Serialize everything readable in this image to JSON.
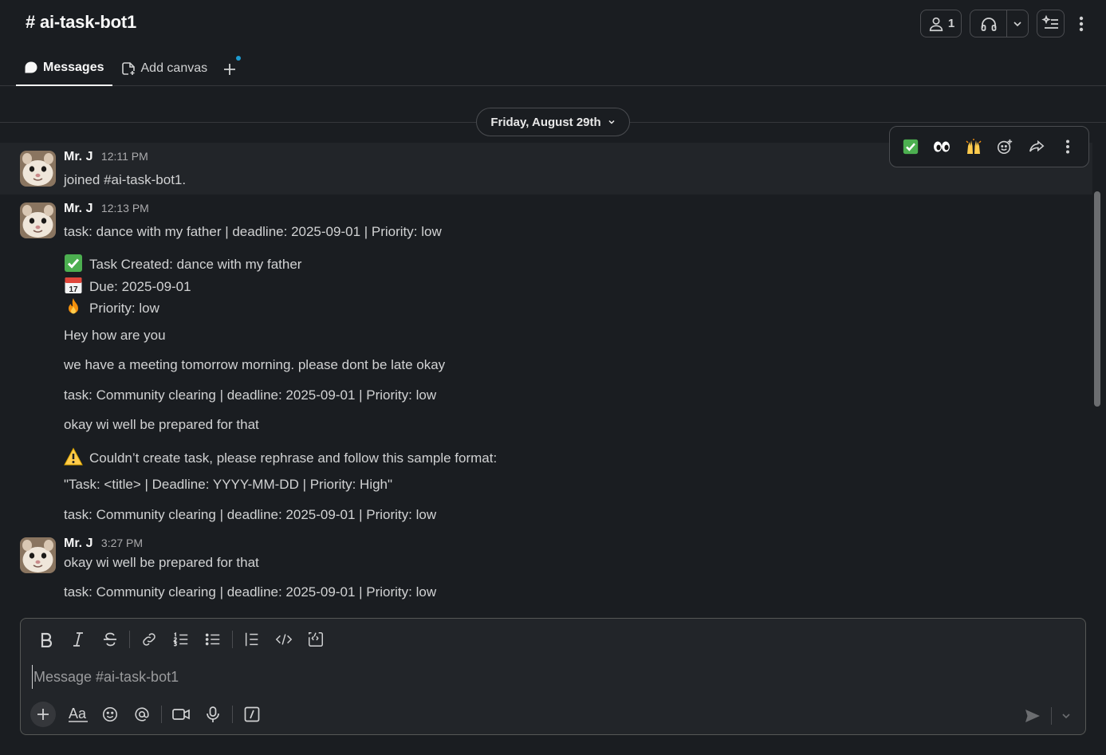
{
  "header": {
    "channel_title": "# ai-task-bot1",
    "member_count": "1"
  },
  "tabs": [
    {
      "label": "Messages",
      "active": true
    },
    {
      "label": "Add canvas",
      "active": false
    }
  ],
  "date_divider": "Friday, August 29th",
  "messages": [
    {
      "author": "Mr. J",
      "time": "12:11 PM",
      "lines": [
        "joined #ai-task-bot1."
      ]
    },
    {
      "author": "Mr. J",
      "time": "12:13 PM",
      "lines": [
        "task: dance with my father | deadline: 2025-09-01 | Priority: low",
        "Task Created: dance with my father",
        "Due: 2025-09-01",
        "Priority: low",
        "Hey how are you",
        "we have a meeting tomorrow morning. please dont be late okay",
        "task: Community clearing | deadline: 2025-09-01 | Priority: low",
        "okay wi well be prepared for that",
        "Couldn’t create task, please rephrase and follow this sample format:",
        "\"Task: <title> | Deadline: YYYY-MM-DD | Priority: High\"",
        "task: Community clearing | deadline: 2025-09-01 | Priority: low"
      ]
    },
    {
      "author": "Mr. J",
      "time": "3:27 PM",
      "lines": [
        "okay wi well be prepared for that",
        "task: Community clearing | deadline: 2025-09-01 | Priority: low"
      ]
    }
  ],
  "composer": {
    "placeholder": "Message #ai-task-bot1"
  },
  "icons": {
    "hover_toolbar": [
      "check-reaction-icon",
      "eyes-reaction-icon",
      "raised-hands-reaction-icon",
      "add-reaction-icon",
      "share-icon",
      "more-actions-icon"
    ],
    "format_bar": [
      "bold-icon",
      "italic-icon",
      "strikethrough-icon",
      "link-icon",
      "ordered-list-icon",
      "bulleted-list-icon",
      "blockquote-icon",
      "code-icon",
      "code-block-icon"
    ],
    "bottom_bar": [
      "attach-plus-icon",
      "formatting-icon",
      "emoji-icon",
      "mention-icon",
      "video-clip-icon",
      "audio-clip-icon",
      "slash-command-icon",
      "send-icon",
      "send-options-icon"
    ]
  },
  "colors": {
    "background": "#1a1d21",
    "hover_row": "#222529",
    "text": "#d1d2d3",
    "accent_dot": "#1d9bd1"
  }
}
